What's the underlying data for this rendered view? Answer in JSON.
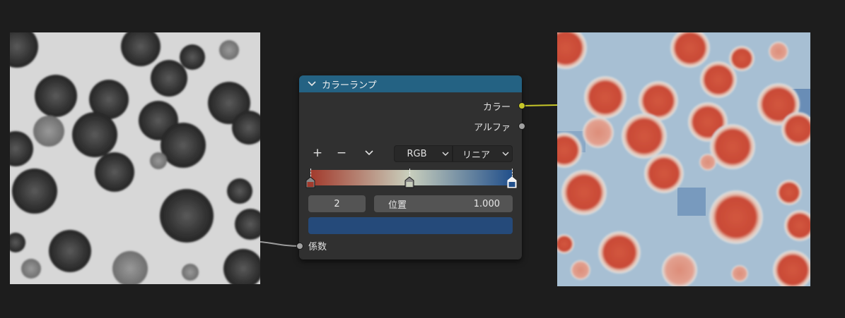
{
  "node": {
    "title": "カラーランプ",
    "outputs": {
      "color_label": "カラー",
      "alpha_label": "アルファ"
    },
    "toolbar": {
      "add_symbol": "+",
      "remove_symbol": "−",
      "color_mode": "RGB",
      "interpolation": "リニア"
    },
    "ramp": {
      "stops": [
        {
          "position": 0.0,
          "color": "#a23a2c"
        },
        {
          "position": 0.49,
          "color": "#c9cfbd"
        },
        {
          "position": 1.0,
          "color": "#22508b"
        }
      ],
      "active_stop_index": "2",
      "position_label": "位置",
      "position_value": "1.000",
      "active_color": "#254a7a"
    },
    "inputs": {
      "factor_label": "係数"
    }
  },
  "colors": {
    "header": "#246283",
    "color_socket": "#c7c729",
    "gray_socket": "#a1a1a1"
  },
  "icons": {
    "collapse": "chevron-down-icon",
    "menu": "chevron-down-icon"
  }
}
